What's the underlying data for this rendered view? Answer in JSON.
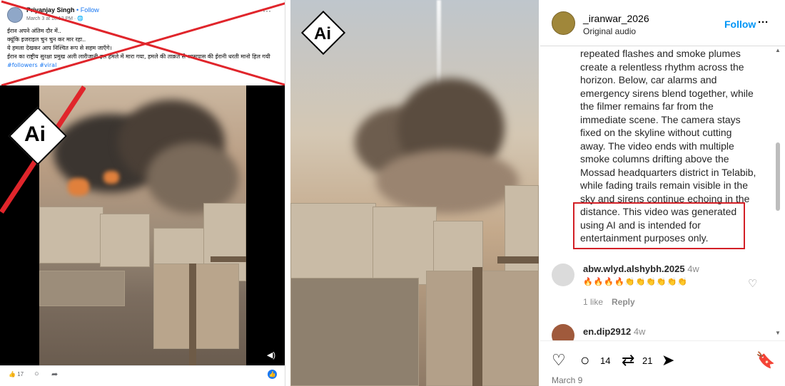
{
  "fb_post": {
    "author": "Priyanjay Singh",
    "follow": "• Follow",
    "date": "March 3 at 10:12 PM · 🌐",
    "lines": [
      "ईरान अपने अंतिम दौर में..",
      "क्यूंकि इजराइल चुन चुन कर मार रहा..",
      "ये हमला देखकर आप निश्चित रूप से सहम जाएँगे।",
      "ईरान का राष्ट्रीय सुरक्षा प्रमुख अली लारीजानी इस हमले में मारा गया, हमले की ताक़त से आसपास की ईरानी धरती मानो हिल गयी"
    ],
    "tags": "#followers #viral",
    "like_count": "17",
    "ai_badge": "Ai"
  },
  "middle_video": {
    "ai_badge": "Ai"
  },
  "ig_post": {
    "username": "_iranwar_2026",
    "audio": "Original audio",
    "follow": "Follow",
    "more": "···",
    "caption_lines": [
      "repeated flashes and smoke plumes",
      "create a relentless rhythm across the",
      "horizon. Below, car alarms and",
      "emergency sirens blend together, while",
      "the filmer remains far from the",
      "immediate scene. The camera stays",
      "fixed on the skyline without cutting",
      "away. The video ends with multiple",
      "smoke columns drifting above the",
      "Mossad headquarters district in Telabib,",
      "while fading trails remain visible in the",
      "sky and sirens continue echoing in the",
      "distance. This video was generated",
      "using AI and is intended for",
      "entertainment purposes only."
    ],
    "comments": [
      {
        "user": "abw.wlyd.alshybh.2025",
        "time": "4w",
        "text": "🔥🔥🔥🔥👏👏👏👏👏👏",
        "likes": "1 like",
        "reply": "Reply"
      },
      {
        "user": "en.dip2912",
        "time": "4w"
      }
    ],
    "comments_count": "14",
    "reposts_count": "21",
    "date": "March 9"
  },
  "colors": {
    "accent": "#0095f6",
    "highlight": "#d21f26",
    "fb_blue": "#1877f2"
  }
}
